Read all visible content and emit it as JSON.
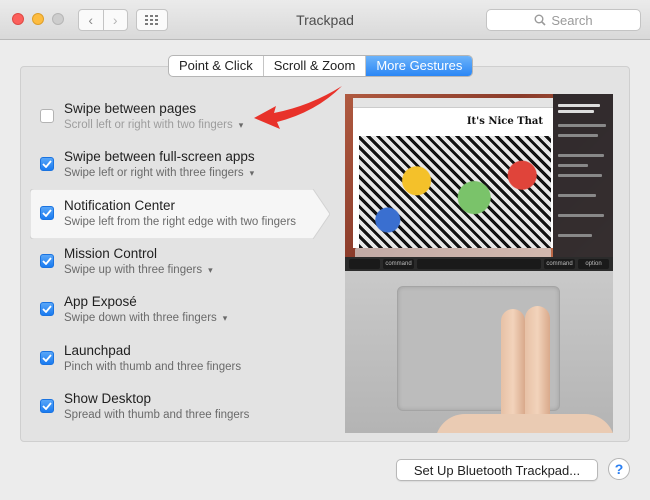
{
  "window": {
    "title": "Trackpad"
  },
  "toolbar": {
    "back_glyph": "‹",
    "forward_glyph": "›",
    "search_placeholder": "Search"
  },
  "tabs": [
    {
      "label": "Point & Click",
      "active": false
    },
    {
      "label": "Scroll & Zoom",
      "active": false
    },
    {
      "label": "More Gestures",
      "active": true
    }
  ],
  "options": [
    {
      "title": "Swipe between pages",
      "subtitle": "Scroll left or right with two fingers",
      "checked": false,
      "has_menu": true
    },
    {
      "title": "Swipe between full-screen apps",
      "subtitle": "Swipe left or right with three fingers",
      "checked": true,
      "has_menu": true
    },
    {
      "title": "Notification Center",
      "subtitle": "Swipe left from the right edge with two fingers",
      "checked": true,
      "has_menu": false,
      "selected": true
    },
    {
      "title": "Mission Control",
      "subtitle": "Swipe up with three fingers",
      "checked": true,
      "has_menu": true
    },
    {
      "title": "App Exposé",
      "subtitle": "Swipe down with three fingers",
      "checked": true,
      "has_menu": true
    },
    {
      "title": "Launchpad",
      "subtitle": "Pinch with thumb and three fingers",
      "checked": true,
      "has_menu": false
    },
    {
      "title": "Show Desktop",
      "subtitle": "Spread with thumb and three fingers",
      "checked": true,
      "has_menu": false
    }
  ],
  "preview": {
    "site_title": "It's Nice That",
    "keys": {
      "command_left": "command",
      "command_right": "command",
      "option": "option"
    }
  },
  "footer": {
    "bluetooth_button": "Set Up Bluetooth Trackpad...",
    "help_glyph": "?"
  },
  "colors": {
    "accent": "#2a86f5",
    "arrow": "#e8322a"
  }
}
